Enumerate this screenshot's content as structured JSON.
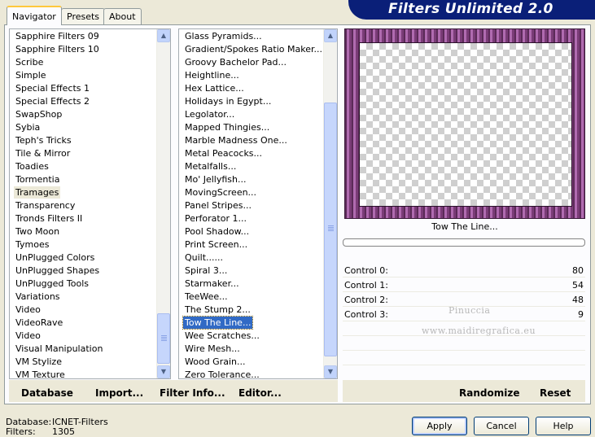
{
  "tabs": [
    {
      "label": "Navigator",
      "active": true
    },
    {
      "label": "Presets",
      "active": false
    },
    {
      "label": "About",
      "active": false
    }
  ],
  "title": "Filters Unlimited 2.0",
  "categories": {
    "items": [
      "Sapphire Filters 09",
      "Sapphire Filters 10",
      "Scribe",
      "Simple",
      "Special Effects 1",
      "Special Effects 2",
      "SwapShop",
      "Sybia",
      "Teph's Tricks",
      "Tile & Mirror",
      "Toadies",
      "Tormentia",
      "Tramages",
      "Transparency",
      "Tronds Filters II",
      "Two Moon",
      "Tymoes",
      "UnPlugged Colors",
      "UnPlugged Shapes",
      "UnPlugged Tools",
      "Variations",
      "Video",
      "VideoRave",
      "Video",
      "Visual Manipulation",
      "VM Stylize",
      "VM Texture"
    ],
    "marked_index": 12
  },
  "filters": {
    "items": [
      "Glass Pyramids...",
      "Gradient/Spokes Ratio Maker...",
      "Groovy Bachelor Pad...",
      "Heightline...",
      "Hex Lattice...",
      "Holidays in Egypt...",
      "Legolator...",
      "Mapped Thingies...",
      "Marble Madness One...",
      "Metal Peacocks...",
      "Metalfalls...",
      "Mo' Jellyfish...",
      "MovingScreen...",
      "Panel Stripes...",
      "Perforator 1...",
      "Pool Shadow...",
      "Print Screen...",
      "Quilt......",
      "Spiral 3...",
      "Starmaker...",
      "TeeWee...",
      "The Stump 2...",
      "Tow The Line...",
      "Wee Scratches...",
      "Wire Mesh...",
      "Wood Grain...",
      "Zero Tolerance..."
    ],
    "selected_index": 22
  },
  "panel_buttons": {
    "database": "Database",
    "import": "Import...",
    "filter_info": "Filter Info...",
    "editor": "Editor...",
    "randomize": "Randomize",
    "reset": "Reset"
  },
  "preview": {
    "filter_name": "Tow The Line..."
  },
  "progress": 0.0,
  "controls": [
    {
      "label": "Control 0:",
      "value": 80
    },
    {
      "label": "Control 1:",
      "value": 54
    },
    {
      "label": "Control 2:",
      "value": 48
    },
    {
      "label": "Control 3:",
      "value": 9
    }
  ],
  "watermark": {
    "line1": "Pinuccia",
    "line2": "www.maidiregrafica.eu"
  },
  "status": {
    "database_label": "Database:",
    "database_value": "ICNET-Filters",
    "filters_label": "Filters:",
    "filters_value": "1305"
  },
  "dialog_buttons": {
    "apply": "Apply",
    "cancel": "Cancel",
    "help": "Help"
  }
}
